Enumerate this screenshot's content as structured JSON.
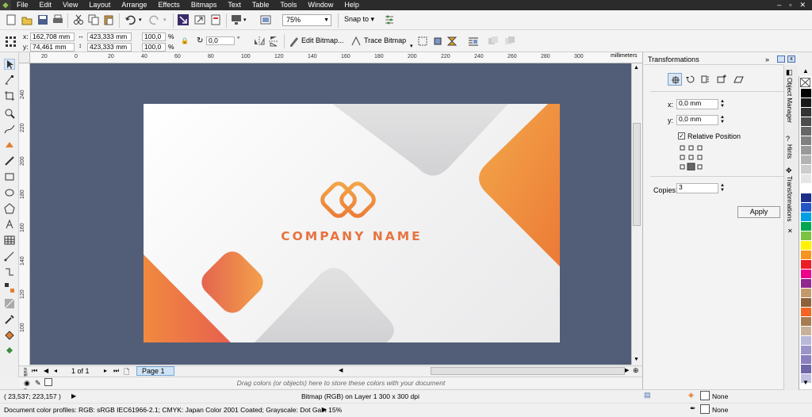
{
  "menu": [
    "File",
    "Edit",
    "View",
    "Layout",
    "Arrange",
    "Effects",
    "Bitmaps",
    "Text",
    "Table",
    "Tools",
    "Window",
    "Help"
  ],
  "window_controls": [
    "–",
    "▫",
    "✕"
  ],
  "toolbar": {
    "zoom": "75%",
    "snap_to": "Snap to"
  },
  "propbar": {
    "x_label": "x:",
    "x_value": "162,708 mm",
    "y_label": "y:",
    "y_value": "74,461 mm",
    "w_value": "423,333 mm",
    "h_value": "423,333 mm",
    "scale_x": "100,0",
    "scale_y": "100,0",
    "pct": "%",
    "angle": "0,0",
    "degree": "°",
    "edit_bitmap": "Edit Bitmap...",
    "trace_bitmap": "Trace Bitmap"
  },
  "ruler": {
    "units": "millimeters",
    "h_ticks": [
      "20",
      "0",
      "20",
      "40",
      "60",
      "80",
      "100",
      "120",
      "140",
      "160",
      "180",
      "200",
      "220",
      "240",
      "260",
      "280",
      "300"
    ],
    "v_ticks": [
      "240",
      "220",
      "200",
      "180",
      "160",
      "140",
      "120",
      "100"
    ]
  },
  "card": {
    "company_name": "COMPANY NAME"
  },
  "pages": {
    "count": "1 of 1",
    "tab": "Page 1"
  },
  "color_tray_hint": "Drag colors (or objects) here to store these colors with your document",
  "status": {
    "coords": "( 23,537; 223,157 )",
    "object_info": "Bitmap (RGB) on Layer 1 300 x 300 dpi",
    "profiles": "Document color profiles: RGB: sRGB IEC61966-2.1; CMYK: Japan Color 2001 Coated; Grayscale: Dot Gain 15%",
    "fill": "None",
    "outline": "None"
  },
  "docker": {
    "title": "Transformations",
    "x_label": "x:",
    "x_value": "0,0 mm",
    "y_label": "y:",
    "y_value": "0,0 mm",
    "relative_position": "Relative Position",
    "copies_label": "Copies:",
    "copies_value": "3",
    "apply": "Apply",
    "side_tabs": [
      "Object Manager",
      "Hints",
      "Transformations"
    ]
  },
  "palette": [
    "#ffffff",
    "#000000",
    "#1a1a1a",
    "#333333",
    "#4d4d4d",
    "#666666",
    "#808080",
    "#999999",
    "#b3b3b3",
    "#cccccc",
    "#e6e6e6",
    "#ffffff",
    "#1b2f8a",
    "#2155c4",
    "#00a0e3",
    "#00a650",
    "#7dc242",
    "#fff200",
    "#f7941d",
    "#ed1c24",
    "#ec008c",
    "#92278f",
    "#c49a6c",
    "#8c6239",
    "#f26522",
    "#a67c52",
    "#c7b299",
    "#b8b8d8",
    "#9b94c8",
    "#8a7fbf",
    "#6f68a8",
    "#c0c0e0"
  ],
  "brand": {
    "orange": "#f0883c",
    "red": "#e8614f",
    "canvas": "#525e77"
  }
}
